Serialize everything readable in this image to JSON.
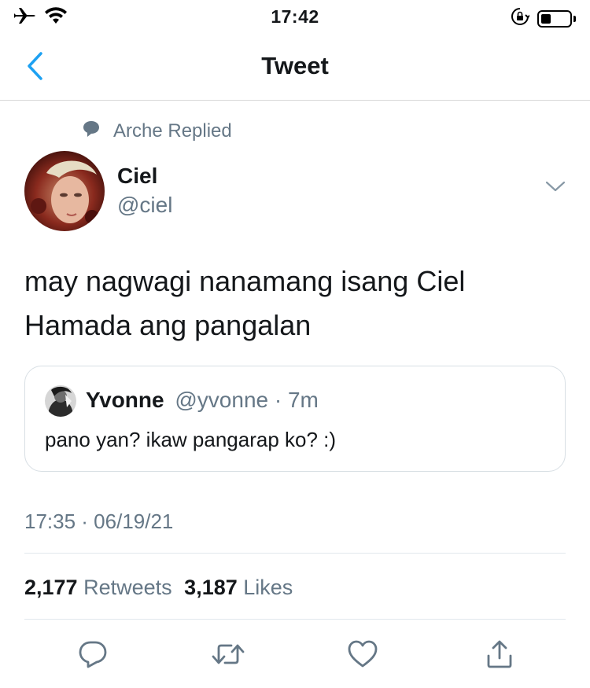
{
  "status_bar": {
    "time": "17:42",
    "battery_level": 0.35
  },
  "nav": {
    "title": "Tweet",
    "back_icon": "chevron-left-icon"
  },
  "context": {
    "replied_label": "Arche Replied",
    "icon": "speech-bubble-icon"
  },
  "author": {
    "name": "Ciel",
    "handle": "@ciel"
  },
  "tweet": {
    "text_line1": "may nagwagi nanamang isang Ciel",
    "text_line2": "Hamada ang pangalan",
    "timestamp": "17:35 · 06/19/21"
  },
  "quoted_tweet": {
    "name": "Yvonne",
    "handle": "@yvonne",
    "separator": " · ",
    "time": "7m",
    "text": "pano yan? ikaw pangarap ko? :)"
  },
  "stats": {
    "retweets_count": "2,177",
    "retweets_label": "Retweets",
    "likes_count": "3,187",
    "likes_label": "Likes"
  },
  "colors": {
    "accent": "#1da1f2",
    "secondary_text": "#657786",
    "primary_text": "#14171a",
    "divider": "#e1e8ed"
  }
}
